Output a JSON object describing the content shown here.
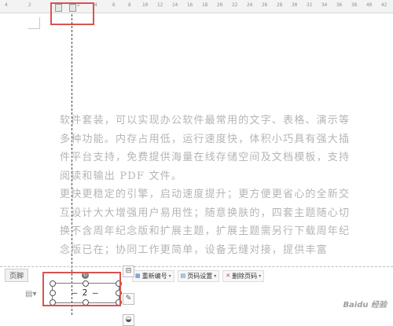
{
  "ruler": {
    "labels": [
      "4",
      "2",
      "2",
      "4",
      "6",
      "8",
      "10",
      "12",
      "14",
      "16",
      "18",
      "20",
      "22",
      "24",
      "26",
      "28",
      "30",
      "32",
      "34",
      "36",
      "38",
      "40",
      "42"
    ]
  },
  "body": {
    "lines": [
      "软件套装，可以实现办公软件最常用的文字、表格、演示等",
      "多种功能。内存占用低，运行速度快，体积小巧具有强大插",
      "件平台支持，免费提供海量在线存储空间及文档模板，支持",
      "阅读和输出 PDF 文件。",
      "更快更稳定的引擎，启动速度提升；更方便更省心的全新交",
      "互设计大大增强用户易用性；随意换肤的，四套主题随心切",
      "换不含周年纪念版和扩展主题，扩展主题需另行下载周年纪",
      "念版已在；协同工作更简单，设备无缝对接，提供丰富"
    ]
  },
  "footer": {
    "label": "页脚",
    "toolbar": {
      "renumber_label": "重新编号",
      "page_setup_label": "页码设置",
      "delete_label": "删除页码"
    },
    "page_number_text": "— 2 —"
  },
  "watermark": "Baidu 经验"
}
